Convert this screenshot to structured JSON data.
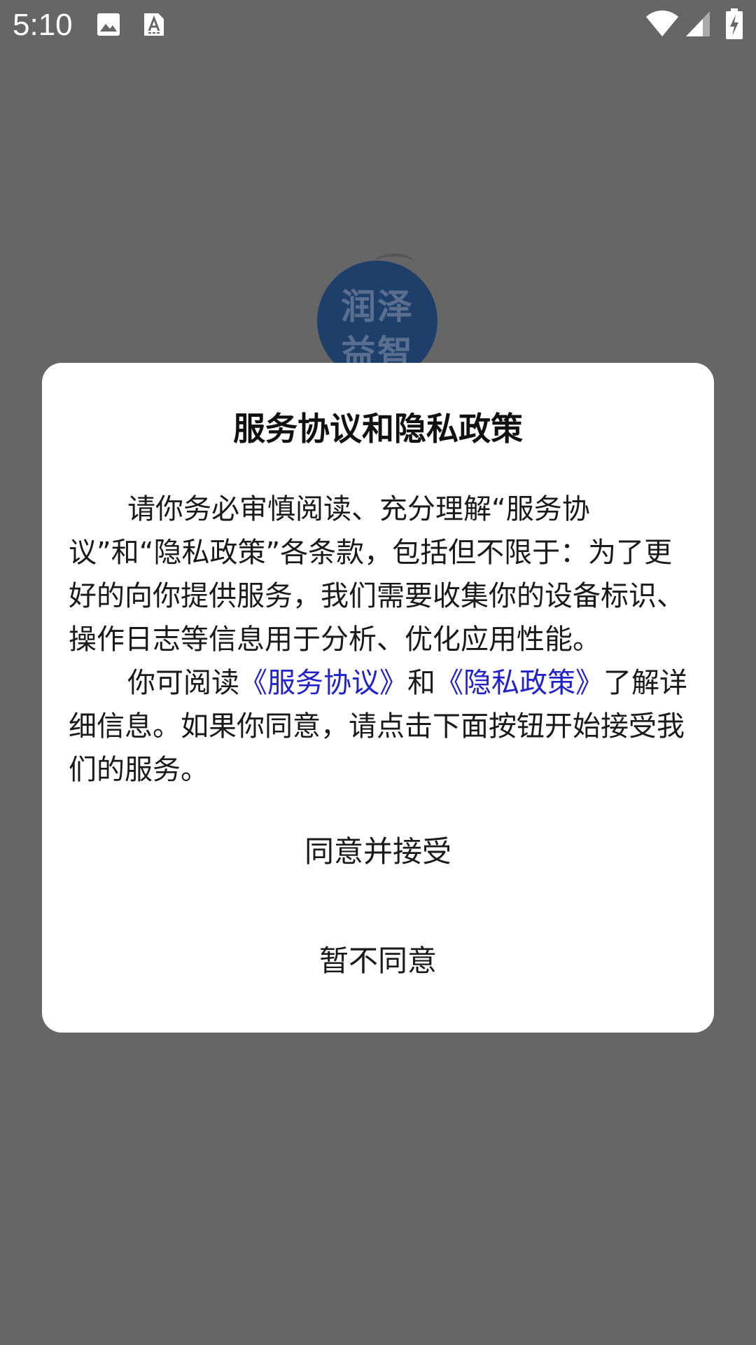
{
  "status_bar": {
    "time": "5:10",
    "left_icons": [
      "image-icon",
      "text-a-icon"
    ],
    "right_icons": [
      "wifi-icon",
      "signal-icon",
      "battery-charging-icon"
    ]
  },
  "background": {
    "logo_text_line1": "润泽",
    "logo_text_line2": "益智"
  },
  "dialog": {
    "title": "服务协议和隐私政策",
    "paragraph1": "请你务必审慎阅读、充分理解“服务协议”和“隐私政策”各条款，包括但不限于：为了更好的向你提供服务，我们需要收集你的设备标识、操作日志等信息用于分析、优化应用性能。",
    "paragraph2_prefix": "你可阅读",
    "service_link": "《服务协议》",
    "paragraph2_and": "和",
    "privacy_link": "《隐私政策》",
    "paragraph2_suffix": "了解详细信息。如果你同意，请点击下面按钮开始接受我们的服务。",
    "agree_button": "同意并接受",
    "disagree_button": "暂不同意"
  },
  "colors": {
    "backdrop": "#666666",
    "dialog_bg": "#ffffff",
    "link": "#2222cc"
  }
}
